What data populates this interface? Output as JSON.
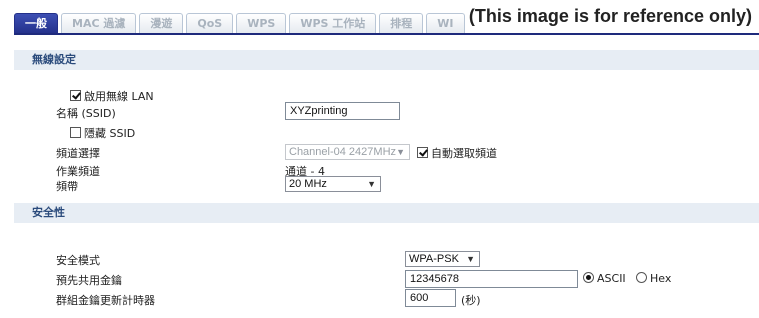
{
  "tabs": [
    {
      "label": "一般",
      "active": true
    },
    {
      "label": "MAC 過濾",
      "active": false
    },
    {
      "label": "漫遊",
      "active": false
    },
    {
      "label": "QoS",
      "active": false
    },
    {
      "label": "WPS",
      "active": false
    },
    {
      "label": "WPS 工作站",
      "active": false
    },
    {
      "label": "排程",
      "active": false
    },
    {
      "label": "WI",
      "active": false
    }
  ],
  "watermark": "(This image is for reference only)",
  "wireless": {
    "section_title": "無線設定",
    "enable_label": "啟用無線 LAN",
    "enable_checked": true,
    "ssid_label": "名稱 (SSID)",
    "ssid_value": "XYZprinting",
    "hide_ssid_label": "隱藏 SSID",
    "hide_ssid_checked": false,
    "channel_select_label": "頻道選擇",
    "channel_select_value": "Channel-04 2427MHz",
    "auto_channel_label": "自動選取頻道",
    "auto_channel_checked": true,
    "working_channel_label": "作業頻道",
    "working_channel_value": "通道 - 4",
    "bandwidth_label": "頻帶",
    "bandwidth_value": "20 MHz"
  },
  "security": {
    "section_title": "安全性",
    "mode_label": "安全模式",
    "mode_value": "WPA-PSK",
    "psk_label": "預先共用金鑰",
    "psk_value": "12345678",
    "ascii_label": "ASCII",
    "hex_label": "Hex",
    "ascii_checked": true,
    "rekey_label": "群組金鑰更新計時器",
    "rekey_value": "600",
    "rekey_unit": "(秒)"
  }
}
